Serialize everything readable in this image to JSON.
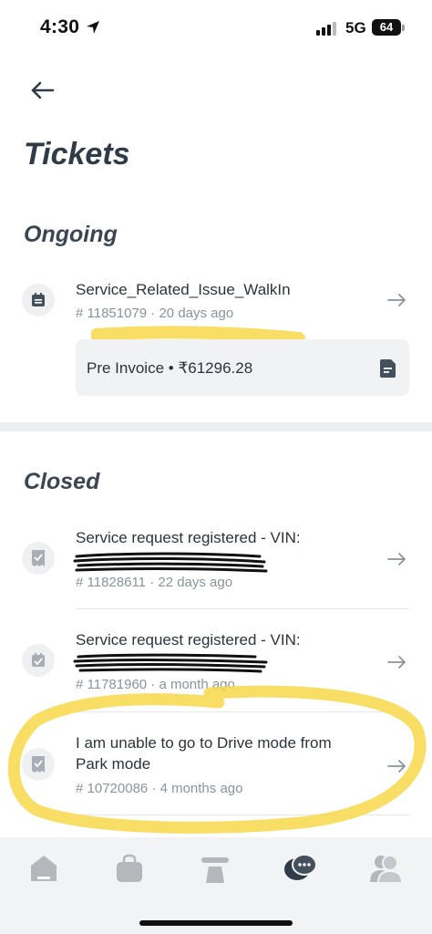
{
  "status_bar": {
    "time": "4:30",
    "network": "5G",
    "battery": "64"
  },
  "header": {
    "title": "Tickets"
  },
  "sections": {
    "ongoing": {
      "title": "Ongoing",
      "tickets": [
        {
          "title": "Service_Related_Issue_WalkIn",
          "meta": "# 11851079 · 20 days ago",
          "invoice_label": "Pre Invoice • ₹61296.28"
        }
      ]
    },
    "closed": {
      "title": "Closed",
      "tickets": [
        {
          "title": "Service request registered - VIN:",
          "meta": "# 11828611 · 22 days ago"
        },
        {
          "title": "Service request registered - VIN:",
          "meta": "# 11781960 · a month ago"
        },
        {
          "title": "I am unable to go to Drive mode from Park mode",
          "meta": "# 10720086 · 4 months ago"
        }
      ]
    }
  },
  "tabbar": {
    "items": [
      "home-icon",
      "bag-icon",
      "vehicle-icon",
      "chat-icon",
      "profile-icon"
    ],
    "active": "chat-icon"
  },
  "colors": {
    "highlight": "#f7d84a",
    "text": "#2f3b46",
    "muted": "#8a939b",
    "card": "#f0f2f4"
  }
}
